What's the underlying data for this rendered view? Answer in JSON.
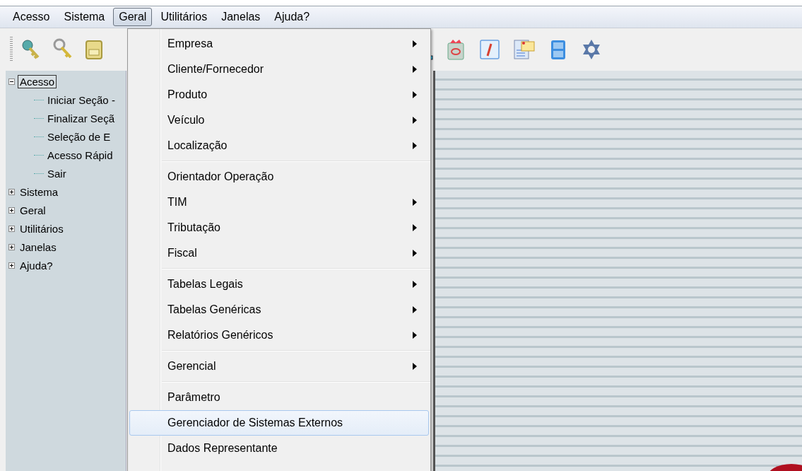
{
  "menubar": [
    {
      "label": "Acesso",
      "selected": false
    },
    {
      "label": "Sistema",
      "selected": false
    },
    {
      "label": "Geral",
      "selected": true
    },
    {
      "label": "Utilitários",
      "selected": false
    },
    {
      "label": "Janelas",
      "selected": false
    },
    {
      "label": "Ajuda?",
      "selected": false
    }
  ],
  "tree": [
    {
      "label": "Acesso",
      "expanded": true,
      "selected": true,
      "children": [
        {
          "label": "Iniciar Seção -",
          "selected": false
        },
        {
          "label": "Finalizar Seçã",
          "selected": false
        },
        {
          "label": "Seleção de E",
          "selected": false
        },
        {
          "label": "Acesso Rápid",
          "selected": false
        },
        {
          "label": "Sair",
          "selected": false
        }
      ]
    },
    {
      "label": "Sistema",
      "expanded": false,
      "selected": false
    },
    {
      "label": "Geral",
      "expanded": false,
      "selected": false
    },
    {
      "label": "Utilitários",
      "expanded": false,
      "selected": false
    },
    {
      "label": "Janelas",
      "expanded": false,
      "selected": false
    },
    {
      "label": "Ajuda?",
      "expanded": false,
      "selected": false
    }
  ],
  "dropdown": {
    "groups": [
      {
        "items": [
          {
            "label": "Empresa",
            "submenu": true,
            "selected": false
          },
          {
            "label": "Cliente/Fornecedor",
            "submenu": true,
            "selected": false
          },
          {
            "label": "Produto",
            "submenu": true,
            "selected": false
          },
          {
            "label": "Veículo",
            "submenu": true,
            "selected": false
          },
          {
            "label": "Localização",
            "submenu": true,
            "selected": false
          }
        ]
      },
      {
        "items": [
          {
            "label": "Orientador Operação",
            "submenu": false,
            "selected": false
          },
          {
            "label": "TIM",
            "submenu": true,
            "selected": false
          },
          {
            "label": "Tributação",
            "submenu": true,
            "selected": false
          },
          {
            "label": "Fiscal",
            "submenu": true,
            "selected": false
          }
        ]
      },
      {
        "items": [
          {
            "label": "Tabelas Legais",
            "submenu": true,
            "selected": false
          },
          {
            "label": "Tabelas Genéricas",
            "submenu": true,
            "selected": false
          },
          {
            "label": "Relatórios Genéricos",
            "submenu": true,
            "selected": false
          }
        ]
      },
      {
        "items": [
          {
            "label": "Gerencial",
            "submenu": true,
            "selected": false
          }
        ]
      },
      {
        "items": [
          {
            "label": "Parâmetro",
            "submenu": false,
            "selected": false
          },
          {
            "label": "Gerenciador de Sistemas Externos",
            "submenu": false,
            "selected": true
          },
          {
            "label": "Dados Representante",
            "submenu": false,
            "selected": false
          }
        ]
      }
    ]
  }
}
